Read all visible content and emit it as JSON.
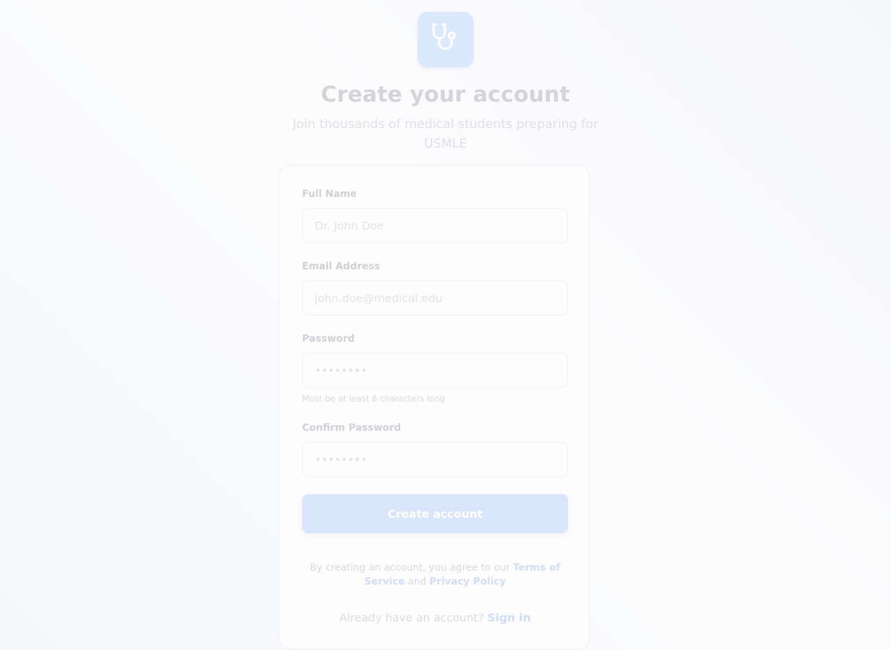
{
  "header": {
    "logo_icon": "stethoscope-icon",
    "title": "Create your account",
    "subtitle": "Join thousands of medical students preparing for USMLE"
  },
  "form": {
    "full_name": {
      "label": "Full Name",
      "placeholder": "Dr. John Doe",
      "value": ""
    },
    "email": {
      "label": "Email Address",
      "placeholder": "john.doe@medical.edu",
      "value": ""
    },
    "password": {
      "label": "Password",
      "placeholder": "••••••••",
      "value": "",
      "hint": "Must be at least 8 characters long"
    },
    "confirm_password": {
      "label": "Confirm Password",
      "placeholder": "••••••••",
      "value": ""
    },
    "submit_label": "Create account"
  },
  "legal": {
    "prefix": "By creating an account, you agree to our ",
    "terms_label": "Terms of Service",
    "middle": " and ",
    "privacy_label": "Privacy Policy"
  },
  "signin": {
    "prompt": "Already have an account? ",
    "link_label": "Sign in"
  },
  "colors": {
    "accent": "#d8e5fb",
    "link": "#d0ddf7",
    "logo_bg": "#dce8fc"
  }
}
